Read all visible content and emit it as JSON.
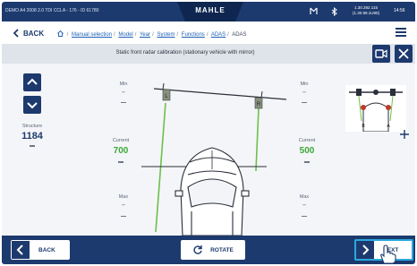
{
  "status_bar": {
    "vehicle_info": "DEMO A4 2008 2.0 TDI CCLA - 176 - ID 61780",
    "logo": "MAHLE",
    "icons": [
      "signal-icon",
      "bluetooth-icon"
    ],
    "version_line1": "1.30.292.115",
    "version_line2": "(1.30.99.1U90)",
    "clock": "14:56"
  },
  "nav": {
    "back_label": "BACK",
    "breadcrumbs": [
      "Manual selection",
      "Model",
      "Year",
      "System",
      "Functions",
      "ADAS"
    ],
    "current": "ADAS"
  },
  "title": "Static front radar calibration (stationary vehicle with mirror)",
  "left_panel": {
    "structure_label": "Structure",
    "structure_value": "1184"
  },
  "left_gauge": {
    "min_label": "Min",
    "min_value": "--",
    "current_label": "Current",
    "current_value": "700",
    "max_label": "Max",
    "max_value": "--"
  },
  "right_gauge": {
    "min_label": "Min",
    "min_value": "--",
    "current_label": "Current",
    "current_value": "500",
    "max_label": "Max",
    "max_value": "--"
  },
  "diagram_marks": {
    "left": "L",
    "right": "R",
    "thumb_left": "B",
    "thumb_right": "A"
  },
  "bottom": {
    "back_label": "BACK",
    "rotate_label": "ROTATE",
    "next_label": "NEXT"
  },
  "colors": {
    "brand": "#1d3a6e",
    "current_value": "#3aa935",
    "laser": "#6cc04a",
    "highlight": "#2aa8e0"
  }
}
